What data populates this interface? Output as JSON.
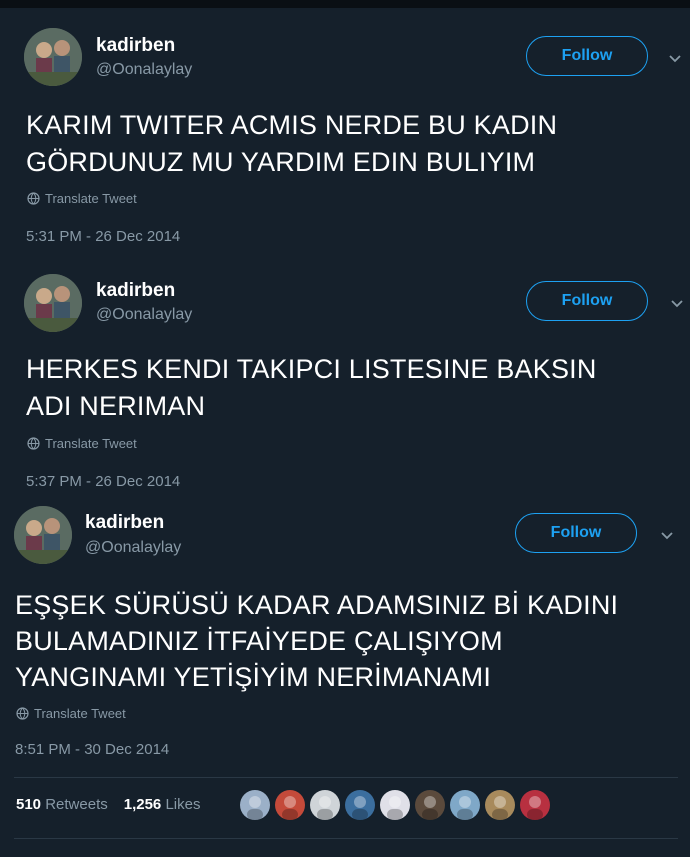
{
  "tweets": [
    {
      "name": "kadirben",
      "handle": "@Oonalaylay",
      "follow_label": "Follow",
      "lines": [
        "KARIM TWITER ACMIS NERDE BU KADIN",
        "GÖRDUNUZ MU YARDIM EDIN BULIYIM"
      ],
      "translate_label": "Translate Tweet",
      "timestamp": "5:31 PM - 26 Dec 2014"
    },
    {
      "name": "kadirben",
      "handle": "@Oonalaylay",
      "follow_label": "Follow",
      "lines": [
        "HERKES KENDI TAKIPCI LISTESINE BAKSIN",
        "ADI NERIMAN"
      ],
      "translate_label": "Translate Tweet",
      "timestamp": "5:37 PM - 26 Dec 2014"
    },
    {
      "name": "kadirben",
      "handle": "@Oonalaylay",
      "follow_label": "Follow",
      "lines": [
        "EŞŞEK SÜRÜSÜ KADAR ADAMSINIZ Bİ KADINI",
        "BULAMADINIZ İTFAİYEDE ÇALIŞIYOM",
        "YANGINAMI YETİŞİYİM NERİMANAMI"
      ],
      "translate_label": "Translate Tweet",
      "timestamp": "8:51 PM - 30 Dec 2014"
    }
  ],
  "stats": {
    "retweets_count": "510",
    "retweets_label": "Retweets",
    "likes_count": "1,256",
    "likes_label": "Likes"
  },
  "colors": {
    "background": "#15202b",
    "accent": "#1da1f2",
    "secondary_text": "#8899a6"
  },
  "icons": {
    "translate": "globe-icon",
    "more": "chevron-down-icon"
  },
  "liker_avatar_colors": [
    "#9bb0c8",
    "#c44a3a",
    "#cfd4d8",
    "#3b6e9e",
    "#e0e0e8",
    "#5b4a3c",
    "#7fa8c8",
    "#a88a5c",
    "#b83040"
  ]
}
